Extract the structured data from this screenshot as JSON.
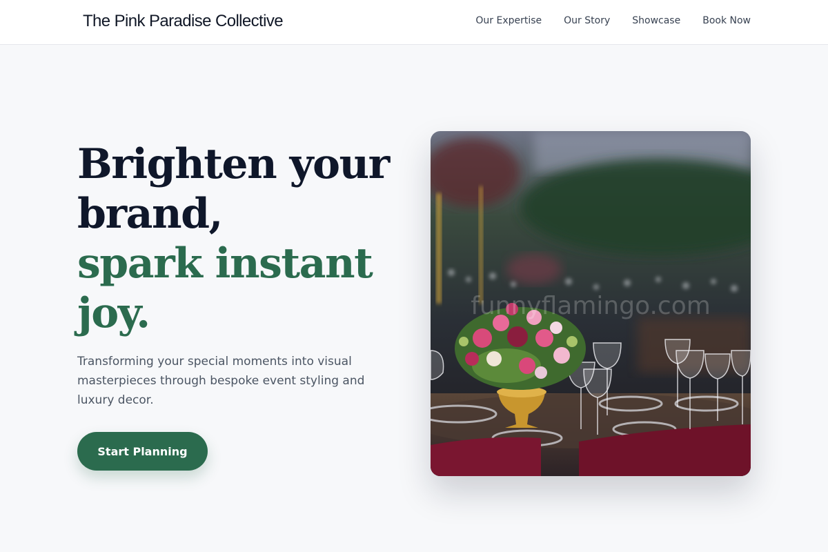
{
  "header": {
    "brand": "The Pink Paradise Collective",
    "nav": [
      {
        "label": "Our Expertise"
      },
      {
        "label": "Our Story"
      },
      {
        "label": "Showcase"
      },
      {
        "label": "Book Now"
      }
    ]
  },
  "hero": {
    "headline_line1": "Brighten your brand,",
    "headline_line2": "spark instant joy.",
    "description": "Transforming your special moments into visual masterpieces through bespoke event styling and luxury decor.",
    "cta_label": "Start Planning",
    "image_watermark": "funnyflamingo.com"
  },
  "colors": {
    "accent": "#2b6b4e",
    "heading": "#0f172a",
    "page_bg": "#f7f8fa"
  }
}
